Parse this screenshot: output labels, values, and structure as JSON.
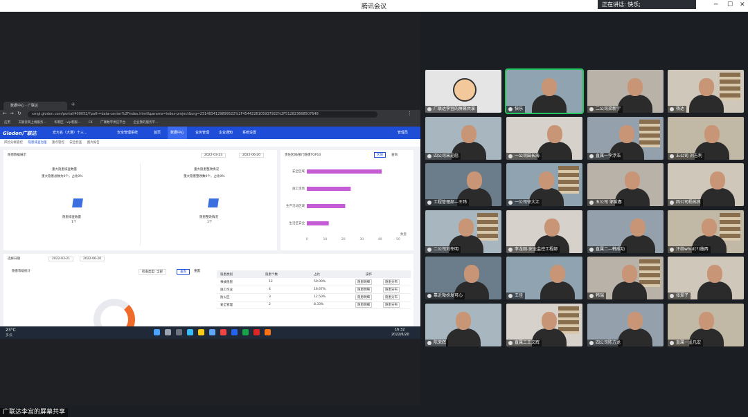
{
  "window": {
    "title": "腾讯会议",
    "speaking": "正在讲话: 快乐;"
  },
  "share_label": "广联达李宫的屏幕共享",
  "browser": {
    "tab_title": "数据中心 - 广联达",
    "url": "xmgl.glodon.com/portal/400052/?path=data-center%2Findex.html&params=index-project&org=2314834129899522%2F4544226105937922%2F512823668507648",
    "bookmarks": [
      "应用",
      "天联云筑上线服务...",
      "华南区 - vip客服...",
      "C4",
      "广联数字供应平台",
      "企业我的服务平..."
    ]
  },
  "app": {
    "logo": "Glodon广联达",
    "project": "宏大名（大港）十三...",
    "nav": [
      "安全管理系统",
      "首页",
      "数据中心",
      "业务管理",
      "企业通知",
      "系统设置"
    ],
    "subnav": [
      "风险分级管控",
      "隐患排查治理",
      "重点管控",
      "安全检查",
      "图片报告"
    ],
    "user": "管理员",
    "panel1": {
      "title": "隐患数据展示",
      "date_from": "2022-03-23",
      "date_to": "2022-06-20",
      "left_title": "重大隐患排查数量",
      "left_sub": "重大隐患总数为0个，占比0%",
      "left_label": "隐患排查数量",
      "left_value": "1个",
      "right_title": "重大隐患整改情况",
      "right_sub": "重大隐患整改数0个，占比0%",
      "right_label": "隐患整改情况",
      "right_value": "1个"
    },
    "panel2": {
      "title": "责任区域/部门隐患TOP10",
      "btn1": "区域",
      "btn2": "查询"
    },
    "panel3": {
      "title": "选择日期",
      "date_from": "2022-03-21",
      "date_to": "2022-06-20",
      "subtitle": "隐患等级统计",
      "filter": "检查类型: 全部",
      "btn": "查询",
      "btn2": "重置",
      "table_headers": [
        "隐患类别",
        "隐患个数",
        "占比",
        "操作"
      ],
      "rows": [
        {
          "cat": "事故隐患",
          "num": "12",
          "pct": "50.00%"
        },
        {
          "cat": "施工作业",
          "num": "4",
          "pct": "16.67%"
        },
        {
          "cat": "防火区",
          "num": "3",
          "pct": "12.50%"
        },
        {
          "cat": "安全管理",
          "num": "2",
          "pct": "8.33%"
        }
      ],
      "action1": "隐患明细",
      "action2": "隐患分布"
    }
  },
  "chart_data": {
    "type": "bar",
    "title": "责任区域/部门隐患TOP10",
    "categories": [
      "安全区域",
      "施工现场",
      "生产活动区域",
      "生活区安全"
    ],
    "values": [
      41,
      24,
      21,
      12
    ],
    "xlim": [
      0,
      50
    ],
    "ticks": [
      "0",
      "10",
      "20",
      "30",
      "40",
      "50"
    ],
    "xlabel": "数量",
    "color": "#c45cd6"
  },
  "taskbar": {
    "weather": "23°C",
    "weather_desc": "多云",
    "time": "16:32",
    "date": "2022/6/20"
  },
  "participants": [
    "广联达李宫的屏幕共享",
    "快乐",
    "二公司梁新宇",
    "杨达",
    "四公司宋迎彪",
    "一公司田长海",
    "直属一李浮浩",
    "五公司 刘吉利",
    "工程管理部—王玮",
    "一公司徐大江",
    "五公司 邹爱春",
    "四公司杨苏良",
    "二公司刘冬明",
    "李龙刚-安全监控工程部",
    "直属二—韩成功",
    "汗蒜whut(?)施西",
    "靠近微扮发可心",
    "王佳",
    "韩瑞",
    "张翠子",
    "陈荣辉",
    "直属三王文辉",
    "四公司陈方龙",
    "直属一孟凡宏"
  ]
}
